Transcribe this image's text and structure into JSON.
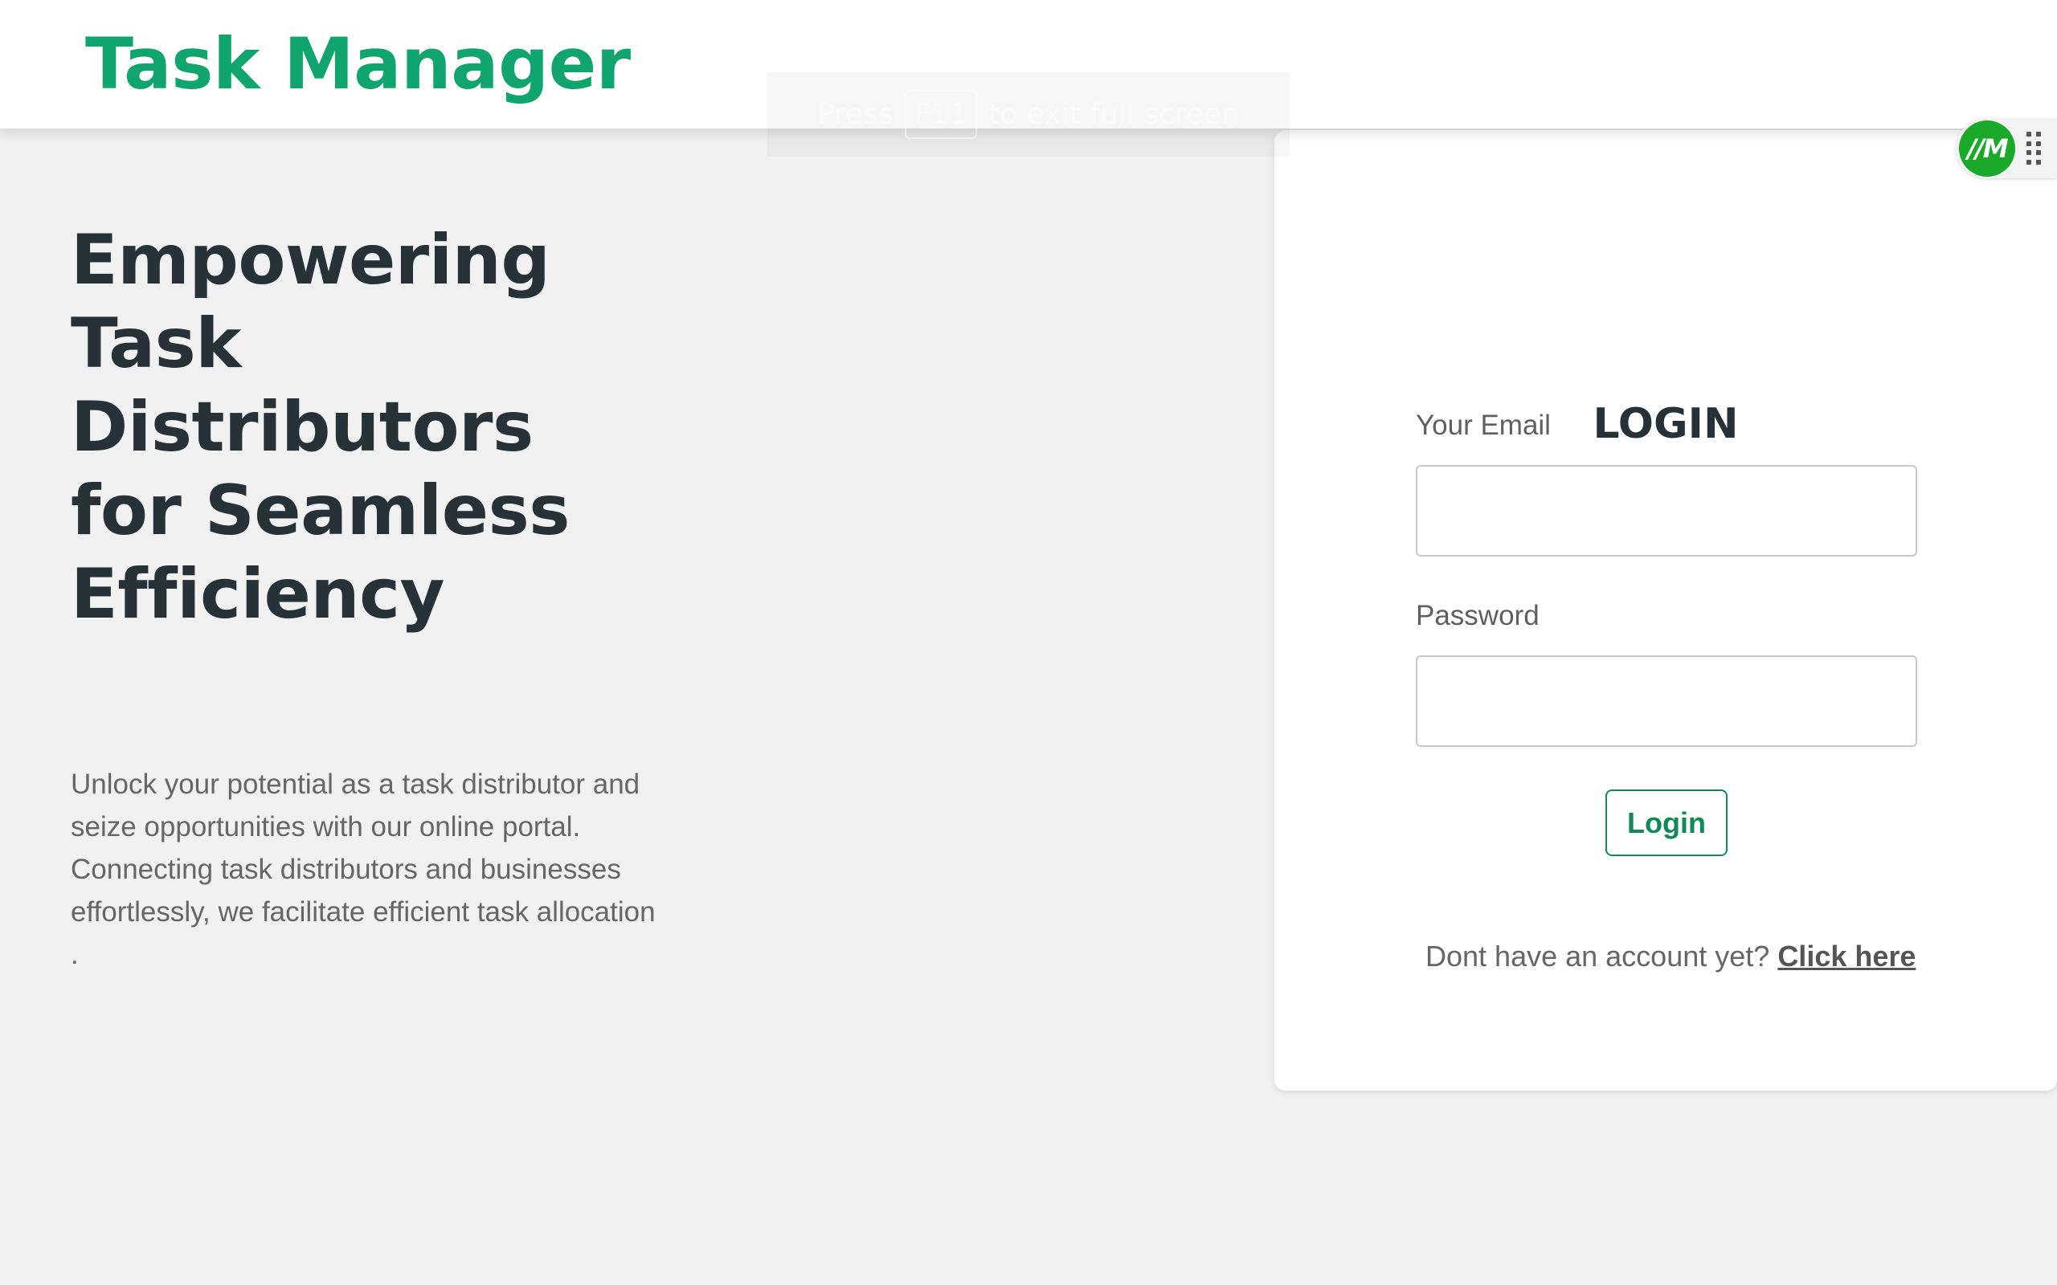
{
  "header": {
    "brand": "Task Manager"
  },
  "fullscreen_hint": {
    "prefix": "Press",
    "key": "F11",
    "suffix": "to exit full screen"
  },
  "hero": {
    "title": "Empowering Task Distributors for Seamless Efficiency",
    "description": "Unlock your potential as a task distributor and seize opportunities with our online portal. Connecting task distributors and businesses effortlessly, we facilitate efficient task allocation ."
  },
  "login": {
    "title": "LOGIN",
    "email_label": "Your Email",
    "email_value": "",
    "password_label": "Password",
    "password_value": "",
    "submit_label": "Login",
    "signup_prompt": "Dont have an account yet?",
    "signup_link": "Click here"
  },
  "extension": {
    "logo_text": "//M",
    "icon": "extension-logo-icon",
    "accent": "#1aa928"
  },
  "colors": {
    "brand": "#10a56f",
    "heading": "#263238",
    "button_border": "#118a5a"
  }
}
